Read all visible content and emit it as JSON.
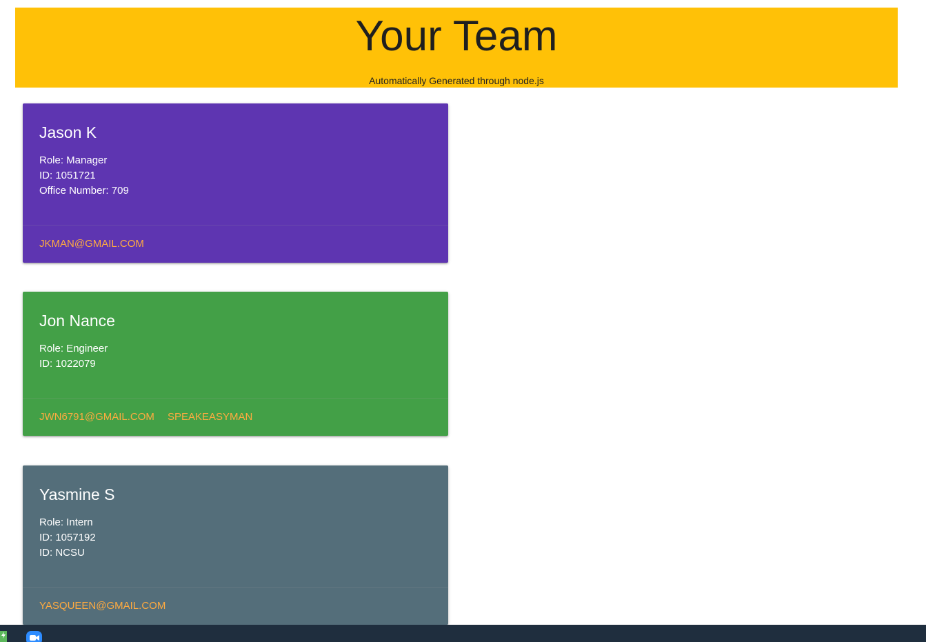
{
  "header": {
    "title": "Your Team",
    "subtitle": "Automatically Generated through node.js",
    "background": "#FFC107"
  },
  "cards": [
    {
      "name": "Jason K",
      "lines": [
        "Role: Manager",
        "ID: 1051721",
        "Office Number: 709"
      ],
      "links": [
        "JKMAN@GMAIL.COM"
      ],
      "background": "#5E35B1"
    },
    {
      "name": "Jon Nance",
      "lines": [
        "Role: Engineer",
        "ID: 1022079"
      ],
      "links": [
        "JWN6791@GMAIL.COM",
        "SPEAKEASYMAN"
      ],
      "background": "#43A047"
    },
    {
      "name": "Yasmine S",
      "lines": [
        "Role: Intern",
        "ID: 1057192",
        "ID: NCSU"
      ],
      "links": [
        "YASQUEEN@GMAIL.COM"
      ],
      "background": "#546E7A"
    }
  ],
  "link_color": "#FFAB40",
  "taskbar": {
    "background": "#1F2E3E",
    "icons": [
      "app-icon",
      "zoom-icon"
    ]
  }
}
